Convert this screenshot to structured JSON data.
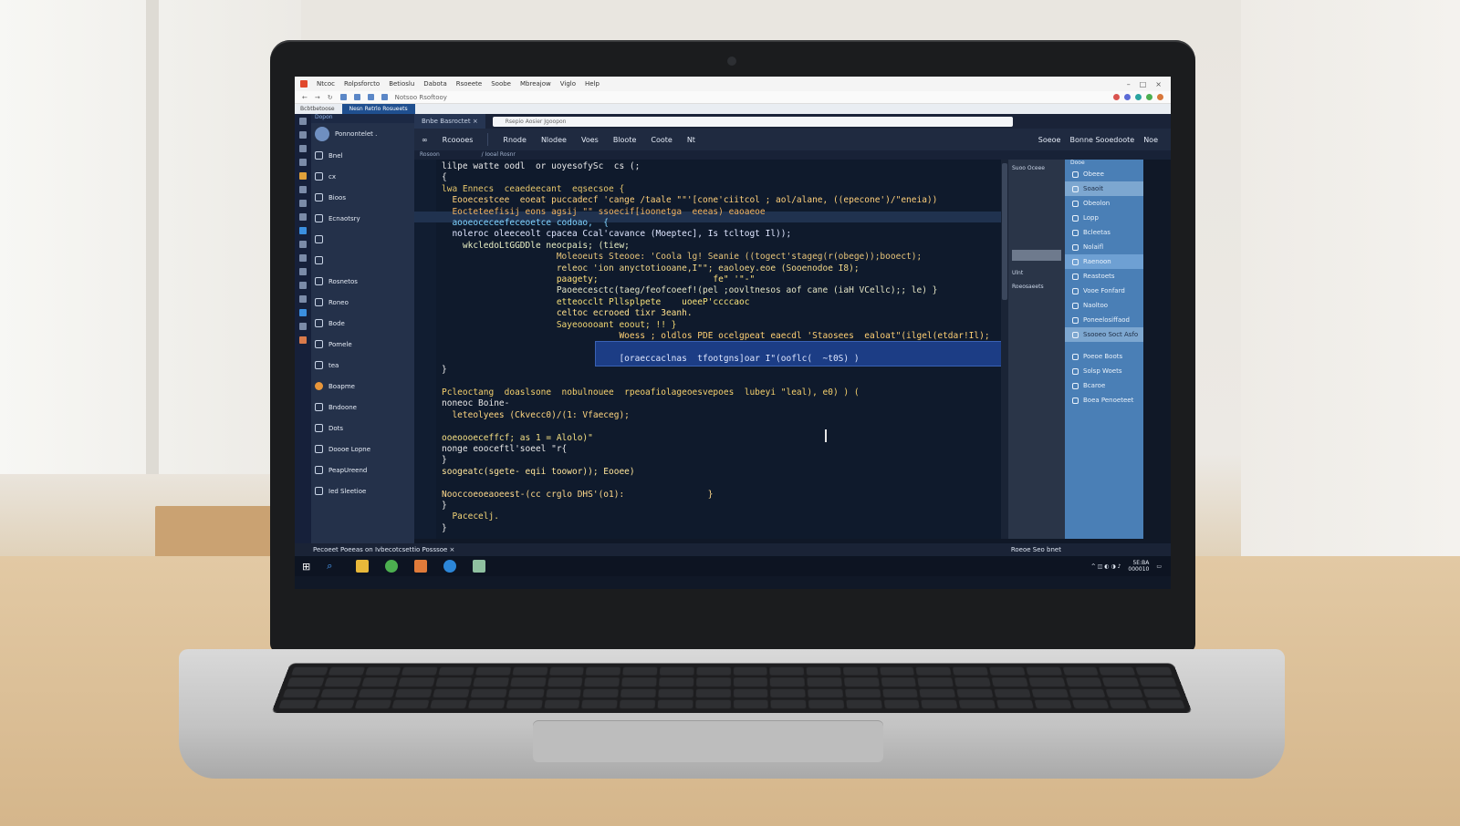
{
  "browser": {
    "title_items": [
      "Ntcoc",
      "Rolpsforcto",
      "Betioslu",
      "Dabota",
      "Rsoeete",
      "Soobe",
      "Mbreajow",
      "Viglo",
      "Help"
    ],
    "address_text": "Notsoo Rsoftooy",
    "tabs": [
      "Bcbtbetoose",
      "Nesn Retrlo Rosueets"
    ],
    "active_search": "Rsepio Aosier Jgoopon"
  },
  "sidebar": {
    "header": "Dopon",
    "profile_name": "Ponnontelet .",
    "items": [
      {
        "label": "Bnel",
        "icon": "file-icon"
      },
      {
        "label": "cx",
        "icon": "folder-icon"
      },
      {
        "label": "Bioos",
        "icon": "gear-icon"
      },
      {
        "label": "Ecnaotsry",
        "icon": "database-icon"
      },
      {
        "label": "",
        "icon": "clipboard-icon"
      },
      {
        "label": "",
        "icon": "page-icon"
      },
      {
        "label": "Rosnetos",
        "icon": "version-icon"
      },
      {
        "label": "Roneo",
        "icon": "pencil-icon"
      },
      {
        "label": "Bode",
        "icon": "clock-icon"
      },
      {
        "label": "Pomele",
        "icon": "table-icon"
      },
      {
        "label": "tea",
        "icon": "list-icon"
      },
      {
        "label": "Boapme",
        "icon": "orange-circle-icon"
      },
      {
        "label": "Bndoone",
        "icon": "grid-icon"
      },
      {
        "label": "Dots",
        "icon": "doc-icon"
      },
      {
        "label": "Doooe Lopne",
        "icon": "folder-open-icon"
      },
      {
        "label": "PeapUreend",
        "icon": "box-icon"
      },
      {
        "label": "Ied Sleetioe",
        "icon": "image-icon"
      }
    ]
  },
  "doc_tab": {
    "label": "Bnbe Basroctet",
    "close": "×"
  },
  "ide_toolbar": {
    "app_label": "Rcoooes",
    "items": [
      "Rnode",
      "Nlodee",
      "Voes",
      "Bloote",
      "Coote",
      "Nt"
    ],
    "right_items": [
      "Soeoe",
      "Bonne Sooedoote",
      "Noe"
    ]
  },
  "breadcrumb": [
    "Rosoon",
    "/ Iooal Rosnr"
  ],
  "code_lines": [
    {
      "text": "lilpe watte oodl  or uoyesofySc  cs (;",
      "color": "#e8e8e8"
    },
    {
      "text": "{",
      "color": "#e8e8e8"
    },
    {
      "text": "lwa Ennecs  ceaedeecant  eqsecsoe {",
      "color": "#e6c66b"
    },
    {
      "text": "  Eooecestcee  eoeat puccadecf 'cange /taale \"\"'[cone'ciitcol ; aol/alane, ((epecone')/\"eneia))",
      "color": "#ffd07a"
    },
    {
      "text": "  Eocteteefisij eons agsij \"\" ssoecif[ioonetga  eeeas) eaoaeoe",
      "color": "#f2b35f"
    },
    {
      "text": "  aooeoceceefeceoetce codoao,  {",
      "color": "#7fd4ff"
    },
    {
      "text": "  noleroc oleeceolt cpacea Ccal'cavance (Moeptec], Is tcltogt Il));",
      "color": "#dfe6ff"
    },
    {
      "text": "    wkcledoLtGGDDle neocpais; (tiew;",
      "color": "#eaf0c5"
    },
    {
      "text": "                      Moleoeuts Steooe: 'Coola lg! Seanie ((togect'stageg(r(obege));booect);",
      "color": "#e8c57a"
    },
    {
      "text": "                      releoc 'ion anyctotiooane,I\"\"; eaoloey.eoe (Sooenodoe I8);",
      "color": "#f3d98a"
    },
    {
      "text": "                      paagety;                      fe\" '\"-\"",
      "color": "#ffe07a"
    },
    {
      "text": "                      Paoeecesctc(taeg/feofcoeef!(pel ;oovltnesos aof cane (iaH VCellc);; le) }",
      "color": "#e5e5c5"
    },
    {
      "text": "                      etteocclt Pllsplpete    uoeeP'ccccaoc",
      "color": "#f7e27a"
    },
    {
      "text": "                      celtoc ecrooed tixr 3eanh.",
      "color": "#ffe18c"
    },
    {
      "text": "                      Sayeooooant eoout; !! }",
      "color": "#f4d873"
    },
    {
      "text": "                                  Woess ; oldlos PDE ocelgpeat eaecdl 'Staosees  ealoat\"(ilgel(etdar!Il);",
      "color": "#ffd074"
    },
    {
      "text": "",
      "color": "#e8e8e8"
    },
    {
      "text": "                                  [oraeccaclnas  tfootgns]oar I\"(ooflc(  ~t0S) )",
      "color": "#dfe7ff"
    },
    {
      "text": "}",
      "color": "#e8e8e8"
    },
    {
      "text": "",
      "color": "#e8e8e8"
    },
    {
      "text": "Pcleoctang  doaslsone  nobulnouee  rpeoafiolageoesvepoes  lubeyi \"leal), e0) ) (",
      "color": "#f6d16d"
    },
    {
      "text": "noneoc Boine-",
      "color": "#e8e8e8"
    },
    {
      "text": "  leteolyees (Ckvecc0)/(1: Vfaeceg);",
      "color": "#ffd680"
    },
    {
      "text": "",
      "color": "#e8e8e8"
    },
    {
      "text": "ooeoooeceffcf; as 1 = Alolo)\"",
      "color": "#f5e083"
    },
    {
      "text": "nonge eooceftl'soeel \"r{",
      "color": "#e8e8e8"
    },
    {
      "text": "}",
      "color": "#e8e8e8"
    },
    {
      "text": "soogeatc(sgete- eqii toowor)); Eooee)",
      "color": "#ffe59a"
    },
    {
      "text": "",
      "color": "#e8e8e8"
    },
    {
      "text": "Nooccoeoeaoeest-(cc crglo DHS'(o1):                }",
      "color": "#ffd98b"
    },
    {
      "text": "}",
      "color": "#e8e8e8"
    },
    {
      "text": "  Pacecelj.",
      "color": "#f5d678"
    },
    {
      "text": "}",
      "color": "#e8e8e8"
    }
  ],
  "outline": {
    "items": [
      "Ulnt",
      "Roeosaeets"
    ],
    "header": "Suoo Oceee"
  },
  "right_panel": {
    "header": "Dooe",
    "items": [
      {
        "label": "Obeee",
        "icon": "gear-icon",
        "state": "normal"
      },
      {
        "label": "Soaoit",
        "icon": "dot-icon",
        "state": "sel2"
      },
      {
        "label": "Obeolon",
        "icon": "refresh-icon",
        "state": "normal"
      },
      {
        "label": "Lopp",
        "icon": "dot-icon",
        "state": "normal"
      },
      {
        "label": "Bcleetas",
        "icon": "dot-icon",
        "state": "normal"
      },
      {
        "label": "Nolaifl",
        "icon": "dot-icon",
        "state": "normal"
      },
      {
        "label": "Raenoon",
        "icon": "folder-icon",
        "state": "sel"
      },
      {
        "label": "Reastoets",
        "icon": "page-icon",
        "state": "normal"
      },
      {
        "label": "Vooe Fonfard",
        "icon": "grid-icon",
        "state": "normal"
      },
      {
        "label": "Naoltoo",
        "icon": "refresh-icon",
        "state": "normal"
      },
      {
        "label": "Poneelosiffaod",
        "icon": "table-icon",
        "state": "normal"
      },
      {
        "label": "Ssooeo Soct Asfo",
        "icon": "doc-icon",
        "state": "sel2"
      },
      {
        "label": "",
        "icon": "",
        "state": "spacer"
      },
      {
        "label": "Poeoe Boots",
        "icon": "box-icon",
        "state": "normal"
      },
      {
        "label": "Solsp Woets",
        "icon": "dot-icon",
        "state": "normal"
      },
      {
        "label": "Bcaroe",
        "icon": "refresh-icon",
        "state": "normal"
      },
      {
        "label": "Boea Penoeteet",
        "icon": "pencil-icon",
        "state": "normal"
      }
    ]
  },
  "statusbar": {
    "left": "Pecoeet Poeeas on Ivbecotcsettio Posssoe ×",
    "right": "Roeoe Seo bnet"
  },
  "taskbar": {
    "time": "5E:BA",
    "date": "000010"
  }
}
